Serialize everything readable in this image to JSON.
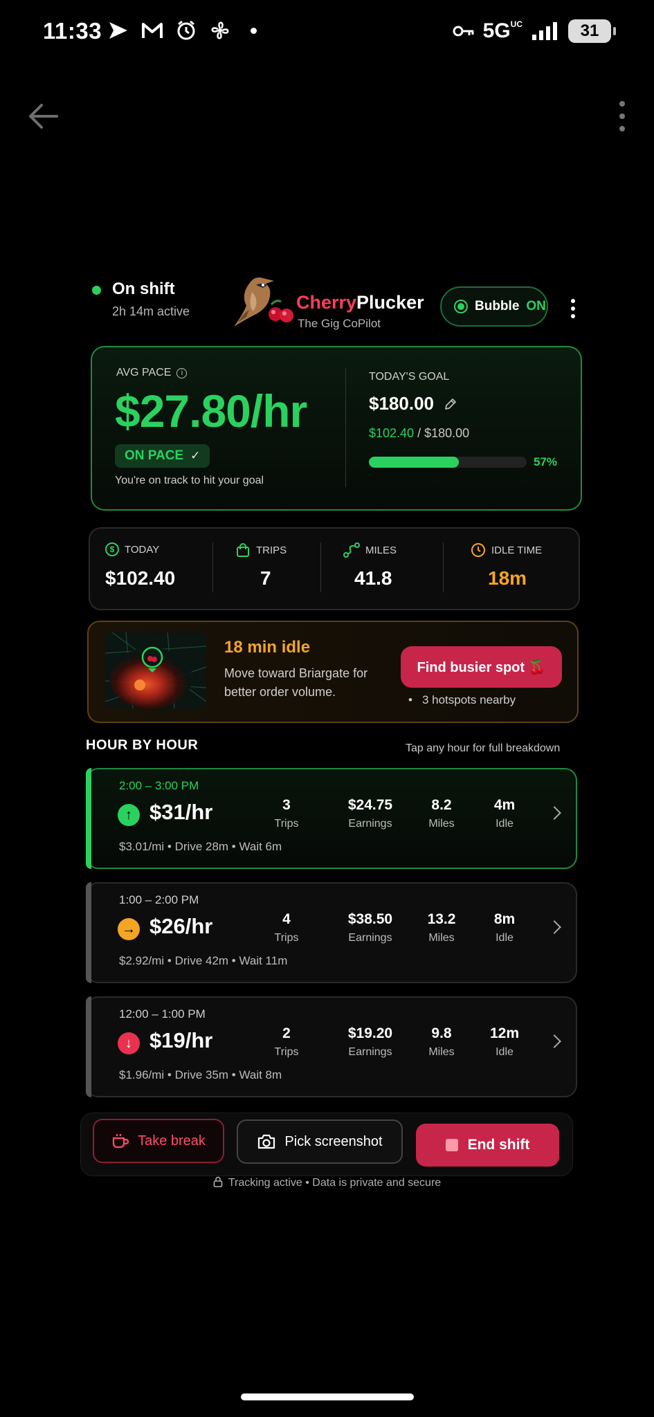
{
  "status_bar": {
    "time": "11:33",
    "network": "5G",
    "network_sup": "UC",
    "battery": "31"
  },
  "header": {
    "status_title": "On shift",
    "status_sub": "2h 14m active",
    "brand_part1": "Cherry",
    "brand_part2": "Plucker",
    "brand_sub": "The Gig CoPilot",
    "bubble_label": "Bubble",
    "bubble_state": "ON"
  },
  "pace": {
    "label": "AVG PACE",
    "value": "$27.80/hr",
    "badge": "ON PACE",
    "note": "You're on track to hit your goal",
    "goal_label": "TODAY'S GOAL",
    "goal_value": "$180.00",
    "progress_current": "$102.40",
    "progress_total": " / $180.00",
    "progress_fraction": 0.57,
    "progress_pct_label": "57%"
  },
  "stats": {
    "today_label": "TODAY",
    "today_value": "$102.40",
    "trips_label": "TRIPS",
    "trips_value": "7",
    "miles_label": "MILES",
    "miles_value": "41.8",
    "idle_label": "IDLE TIME",
    "idle_value": "18m"
  },
  "idle_alert": {
    "title": "18 min idle",
    "text": "Move toward Briargate for better order volume.",
    "button": "Find busier spot 🍒",
    "hotspots": "3 hotspots nearby"
  },
  "hour_by_hour": {
    "title": "HOUR BY HOUR",
    "hint": "Tap any hour for full breakdown",
    "rows": [
      {
        "time": "2:00 – 3:00 PM",
        "rate": "$31/hr",
        "trend": "up",
        "trips": "3",
        "trips_label": "Trips",
        "earnings": "$24.75",
        "earnings_label": "Earnings",
        "miles": "8.2",
        "miles_label": "Miles",
        "idle": "4m",
        "idle_label": "Idle",
        "sub": "$3.01/mi  •  Drive 28m  •  Wait 6m"
      },
      {
        "time": "1:00 – 2:00 PM",
        "rate": "$26/hr",
        "trend": "right",
        "trips": "4",
        "trips_label": "Trips",
        "earnings": "$38.50",
        "earnings_label": "Earnings",
        "miles": "13.2",
        "miles_label": "Miles",
        "idle": "8m",
        "idle_label": "Idle",
        "sub": "$2.92/mi  •  Drive 42m  •  Wait 11m"
      },
      {
        "time": "12:00 – 1:00 PM",
        "rate": "$19/hr",
        "trend": "down",
        "trips": "2",
        "trips_label": "Trips",
        "earnings": "$19.20",
        "earnings_label": "Earnings",
        "miles": "9.8",
        "miles_label": "Miles",
        "idle": "12m",
        "idle_label": "Idle",
        "sub": "$1.96/mi  •  Drive 35m  •  Wait 8m"
      }
    ]
  },
  "actions": {
    "take_break": "Take break",
    "pick_screenshot": "Pick screenshot",
    "end_shift": "End shift",
    "tracking_note": "Tracking active  •  Data is private and secure"
  },
  "colors": {
    "accent_green": "#2bd15f",
    "accent_red": "#c8254a",
    "accent_orange": "#f5a524"
  }
}
